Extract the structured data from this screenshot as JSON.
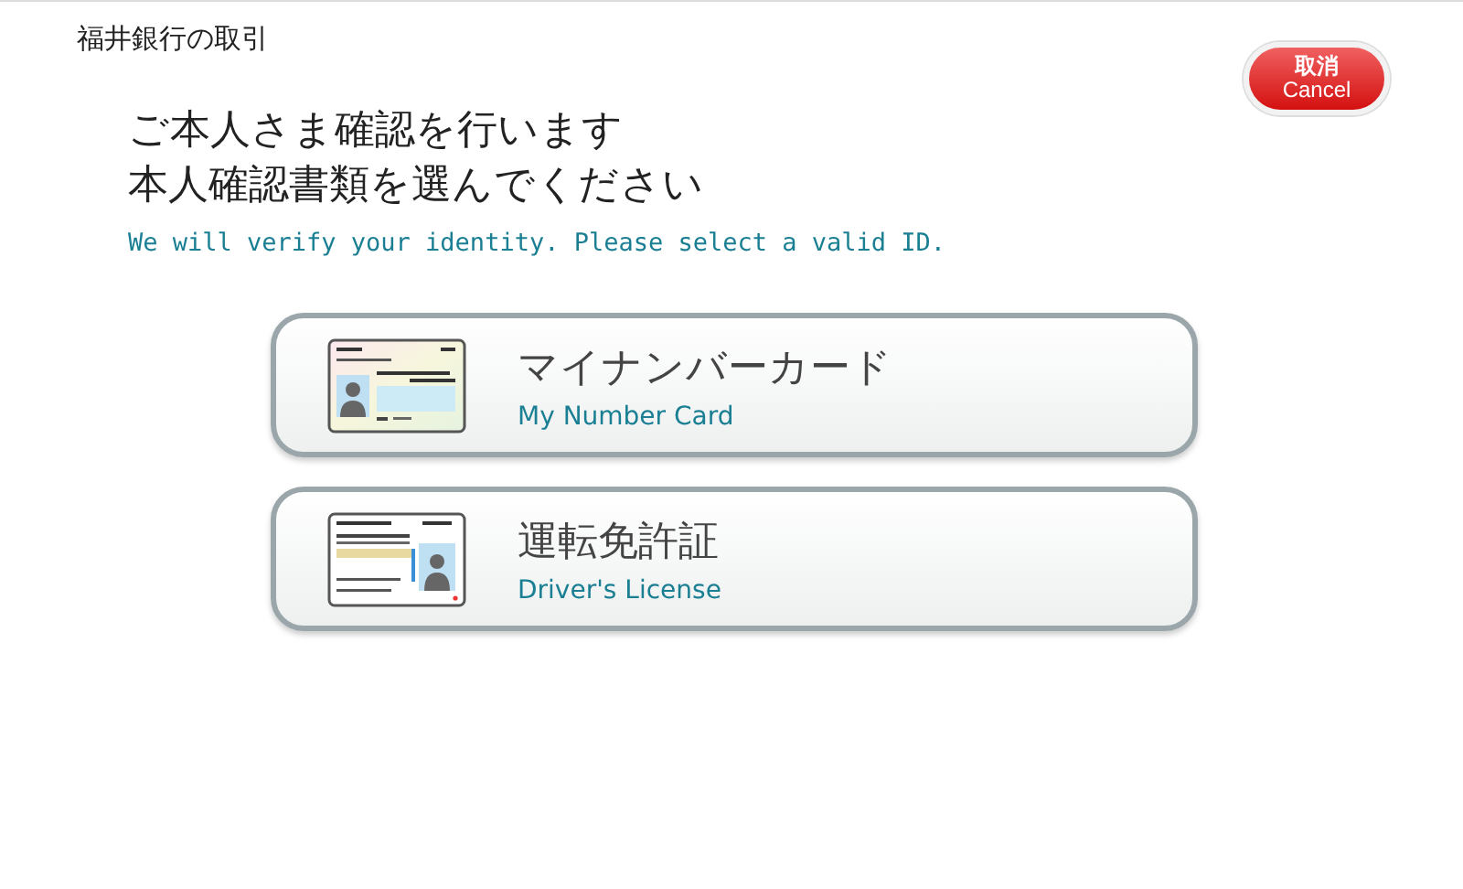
{
  "header": {
    "title": "福井銀行の取引"
  },
  "cancel_button": {
    "label": "取消",
    "sublabel": "Cancel"
  },
  "heading": {
    "lines": [
      "ご本人さま確認を行います",
      "本人確認書類を選んでください"
    ],
    "subtitle": "We will verify your identity. Please select a valid ID."
  },
  "options": [
    {
      "kind": "my_number",
      "label": "マイナンバーカード",
      "sublabel": "My Number Card"
    },
    {
      "kind": "license",
      "label": "運転免許証",
      "sublabel": "Driver's License"
    }
  ]
}
